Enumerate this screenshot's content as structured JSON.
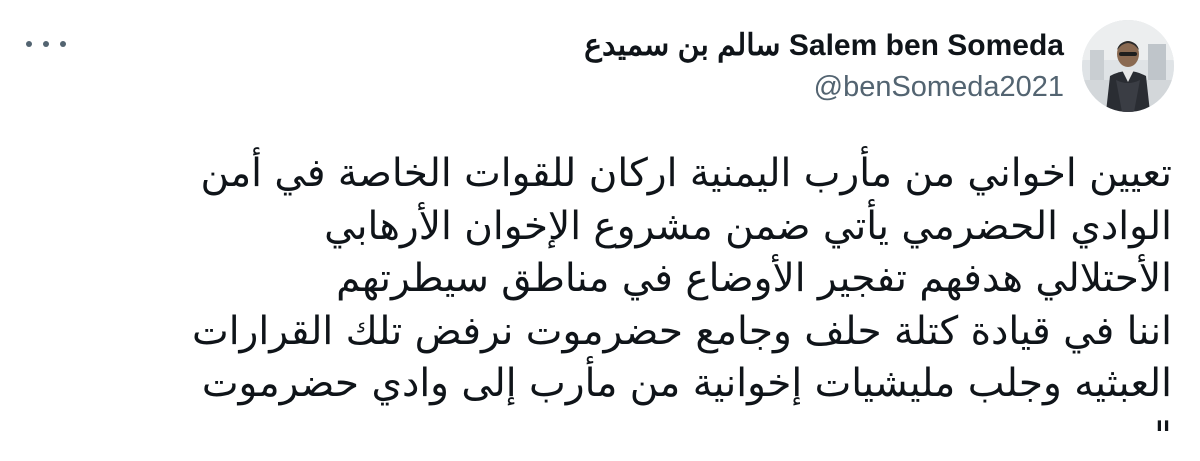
{
  "tweet": {
    "author": {
      "display_name": "سالم بن سميدع Salem ben Someda",
      "handle": "@benSomeda2021",
      "avatar_icon": "user-photo"
    },
    "more_icon": "more-horizontal-icon",
    "text_lines": [
      "تعيين اخواني من مأرب اليمنية اركان للقوات الخاصة في أمن",
      "الوادي الحضرمي يأتي ضمن مشروع الإخوان الأرهابي",
      "الأحتلالي  هدفهم تفجير الأوضاع في مناطق سيطرتهم",
      "اننا في قيادة كتلة حلف وجامع حضرموت نرفض تلك القرارات",
      "العبثيه وجلب مليشيات إخوانية من مأرب إلى وادي حضرموت",
      "\""
    ]
  },
  "colors": {
    "text_primary": "#0f1419",
    "text_secondary": "#536471",
    "background": "#ffffff"
  }
}
